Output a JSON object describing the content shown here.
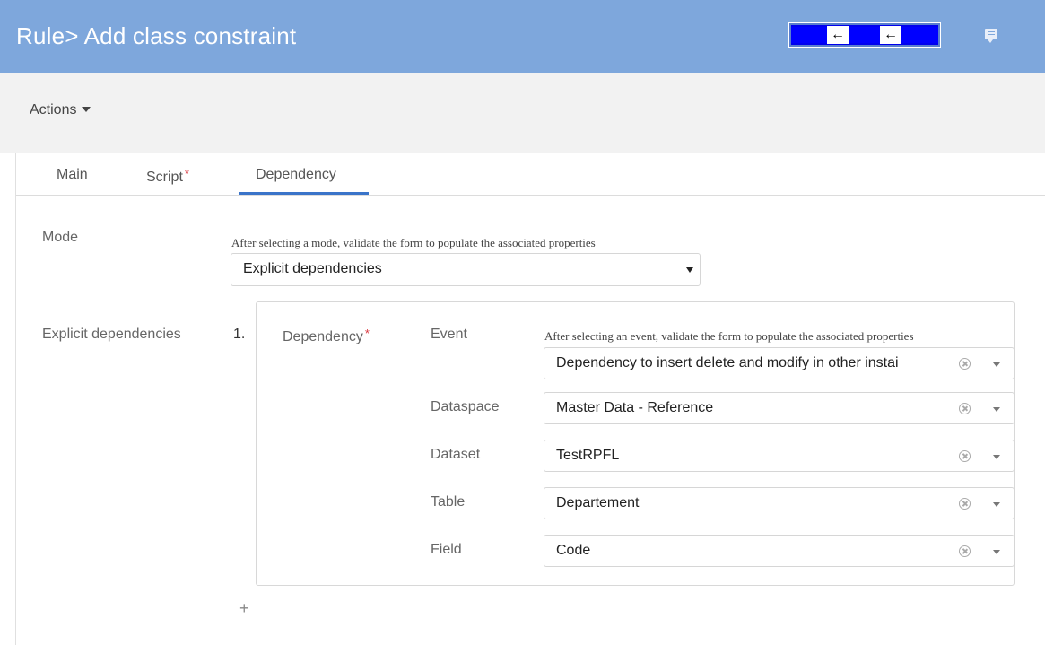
{
  "header": {
    "title": "Rule> Add class constraint",
    "nav_arrow_left": "←",
    "nav_arrow_right": "←",
    "chat_icon": "chat-icon"
  },
  "actions": {
    "label": "Actions"
  },
  "tabs": [
    {
      "label": "Main",
      "required": false
    },
    {
      "label": "Script",
      "required": true,
      "required_mark": "*"
    },
    {
      "label": "Dependency",
      "required": false,
      "active": true
    }
  ],
  "form": {
    "mode": {
      "label": "Mode",
      "hint": "After selecting a mode, validate the form to populate the associated properties",
      "value": "Explicit dependencies"
    },
    "explicit": {
      "label": "Explicit dependencies",
      "index": "1.",
      "dependency_label": "Dependency",
      "required_mark": "*",
      "fields": {
        "event": {
          "label": "Event",
          "hint": "After selecting an event, validate the form to populate the associated properties",
          "value": "Dependency to insert delete and modify in other instai"
        },
        "dataspace": {
          "label": "Dataspace",
          "value": "Master Data - Reference"
        },
        "dataset": {
          "label": "Dataset",
          "value": "TestRPFL"
        },
        "table": {
          "label": "Table",
          "value": "Departement"
        },
        "field": {
          "label": "Field",
          "value": "Code"
        }
      }
    },
    "add_label": "+"
  },
  "colors": {
    "header_bg": "#7ea7dc",
    "accent": "#3a74c9",
    "required": "#d9363e"
  }
}
